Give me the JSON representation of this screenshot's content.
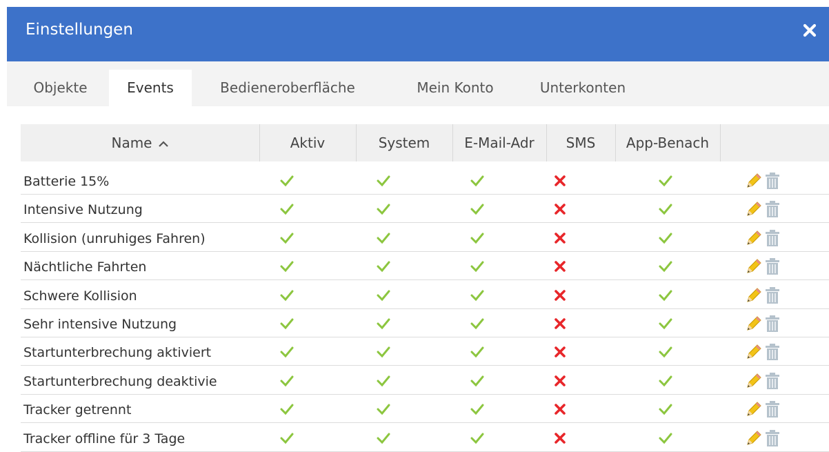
{
  "header": {
    "title": "Einstellungen",
    "close_icon": "close-icon"
  },
  "tabs": [
    {
      "label": "Objekte",
      "active": false
    },
    {
      "label": "Events",
      "active": true
    },
    {
      "label": "Bedieneroberfläche",
      "active": false
    },
    {
      "label": "Mein Konto",
      "active": false
    },
    {
      "label": "Unterkonten",
      "active": false
    }
  ],
  "table": {
    "columns": [
      "Name",
      "Aktiv",
      "System",
      "E-Mail-Adr",
      "SMS",
      "App-Benach"
    ],
    "sort": {
      "column": "Name",
      "direction": "ascending",
      "icon": "chevron-up-icon"
    },
    "status_icons": {
      "yes": "check-icon",
      "no": "cross-icon"
    },
    "colors": {
      "yes": "#8cc63f",
      "no": "#e8262a",
      "header": "#3d72c9"
    },
    "rows": [
      {
        "name": "Batterie 15%",
        "aktiv": true,
        "system": true,
        "email": true,
        "sms": false,
        "app": true
      },
      {
        "name": "Intensive Nutzung",
        "aktiv": true,
        "system": true,
        "email": true,
        "sms": false,
        "app": true
      },
      {
        "name": "Kollision (unruhiges Fahren)",
        "aktiv": true,
        "system": true,
        "email": true,
        "sms": false,
        "app": true
      },
      {
        "name": "Nächtliche Fahrten",
        "aktiv": true,
        "system": true,
        "email": true,
        "sms": false,
        "app": true
      },
      {
        "name": "Schwere Kollision",
        "aktiv": true,
        "system": true,
        "email": true,
        "sms": false,
        "app": true
      },
      {
        "name": "Sehr intensive Nutzung",
        "aktiv": true,
        "system": true,
        "email": true,
        "sms": false,
        "app": true
      },
      {
        "name": "Startunterbrechung aktiviert",
        "aktiv": true,
        "system": true,
        "email": true,
        "sms": false,
        "app": true
      },
      {
        "name": "Startunterbrechung deaktivie",
        "aktiv": true,
        "system": true,
        "email": true,
        "sms": false,
        "app": true
      },
      {
        "name": "Tracker getrennt",
        "aktiv": true,
        "system": true,
        "email": true,
        "sms": false,
        "app": true
      },
      {
        "name": "Tracker offline für 3 Tage",
        "aktiv": true,
        "system": true,
        "email": true,
        "sms": false,
        "app": true
      }
    ],
    "row_actions": [
      "edit-pencil-icon",
      "delete-trash-icon"
    ]
  }
}
